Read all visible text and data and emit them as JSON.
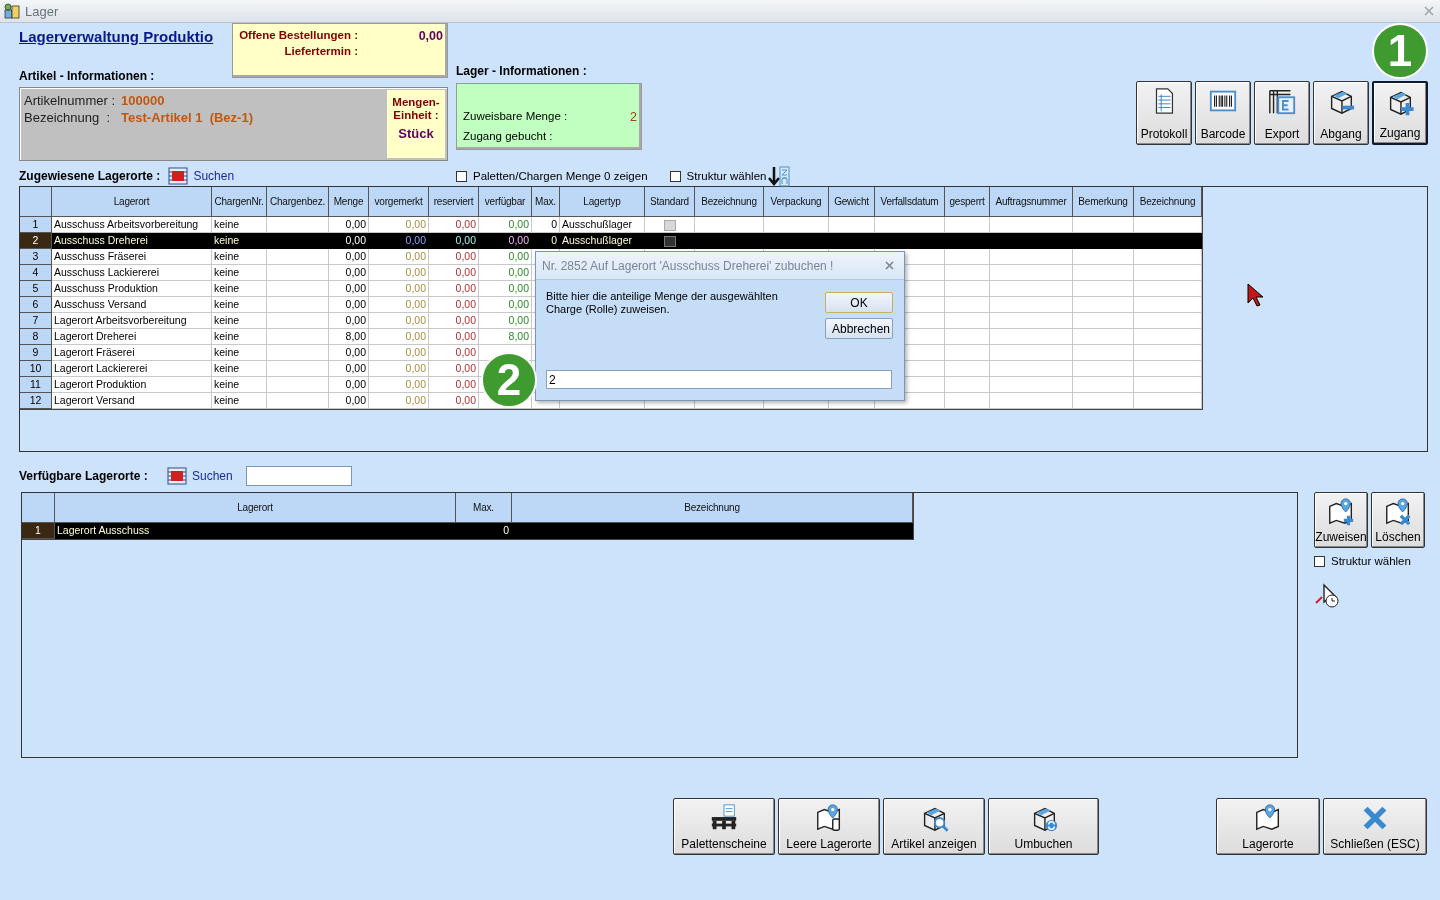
{
  "window": {
    "title": "Lager"
  },
  "header": {
    "title": "Lagerverwaltung Produktio"
  },
  "orders": {
    "open_label": "Offene Bestellungen :",
    "open_value": "0,00",
    "delivery_label": "Liefertermin :"
  },
  "article": {
    "section_label": "Artikel - Informationen :",
    "number_label": "Artikelnummer :",
    "number": "100000",
    "name_label": "Bezeichnung  :",
    "name": "Test-Artikel 1  (Bez-1)",
    "unit_label": "Mengen-Einheit :",
    "unit": "Stück"
  },
  "storage": {
    "section_label": "Lager - Informationen :",
    "assignable_label": "Zuweisbare Menge :",
    "assignable_value": "2",
    "booked_label": "Zugang gebucht :"
  },
  "toolbar": [
    {
      "label": "Protokoll",
      "selected": false
    },
    {
      "label": "Barcode",
      "selected": false
    },
    {
      "label": "Export",
      "selected": false
    },
    {
      "label": "Abgang",
      "selected": false
    },
    {
      "label": "Zugang",
      "selected": true
    }
  ],
  "callouts": [
    {
      "label": "1"
    },
    {
      "label": "2"
    }
  ],
  "assigned": {
    "label": "Zugewiesene Lagerorte :",
    "search": "Suchen",
    "options": [
      {
        "label": "Paletten/Chargen Menge 0 zeigen",
        "checked": false
      },
      {
        "label": "Struktur wählen",
        "checked": false
      }
    ],
    "table": {
      "columns": [
        "Lagerort",
        "ChargenNr.",
        "Chargenbez.",
        "Menge",
        "vorgemerkt",
        "reserviert",
        "verfügbar",
        "Max.",
        "Lagertyp",
        "Standard",
        "Bezeichnung",
        "Verpackung",
        "Gewicht",
        "Verfallsdatum",
        "gesperrt",
        "Auftragsnummer",
        "Bemerkung",
        "Bezeichnung"
      ],
      "rows": [
        {
          "num": "1",
          "lagerort": "Ausschuss Arbeitsvorbereitung",
          "charge": "keine",
          "menge": "0,00",
          "vorgemerkt": "0,00",
          "reserviert": "0,00",
          "verfuegbar": "0,00",
          "max": "0",
          "lagertyp": "Ausschußlager",
          "standard": false,
          "selected": false
        },
        {
          "num": "2",
          "lagerort": "Ausschuss Dreherei",
          "charge": "keine",
          "menge": "0,00",
          "vorgemerkt": "0,00",
          "reserviert": "0,00",
          "verfuegbar": "0,00",
          "max": "0",
          "lagertyp": "Ausschußlager",
          "standard": false,
          "selected": true
        },
        {
          "num": "3",
          "lagerort": "Ausschuss Fräserei",
          "charge": "keine",
          "menge": "0,00",
          "vorgemerkt": "0,00",
          "reserviert": "0,00",
          "verfuegbar": "0,00",
          "selected": false
        },
        {
          "num": "4",
          "lagerort": "Ausschuss Lackiererei",
          "charge": "keine",
          "menge": "0,00",
          "vorgemerkt": "0,00",
          "reserviert": "0,00",
          "verfuegbar": "0,00",
          "selected": false
        },
        {
          "num": "5",
          "lagerort": "Ausschuss Produktion",
          "charge": "keine",
          "menge": "0,00",
          "vorgemerkt": "0,00",
          "reserviert": "0,00",
          "verfuegbar": "0,00",
          "selected": false
        },
        {
          "num": "6",
          "lagerort": "Ausschuss Versand",
          "charge": "keine",
          "menge": "0,00",
          "vorgemerkt": "0,00",
          "reserviert": "0,00",
          "verfuegbar": "0,00",
          "selected": false
        },
        {
          "num": "7",
          "lagerort": "Lagerort Arbeitsvorbereitung",
          "charge": "keine",
          "menge": "0,00",
          "vorgemerkt": "0,00",
          "reserviert": "0,00",
          "verfuegbar": "0,00",
          "selected": false
        },
        {
          "num": "8",
          "lagerort": "Lagerort Dreherei",
          "charge": "keine",
          "menge": "8,00",
          "vorgemerkt": "0,00",
          "reserviert": "0,00",
          "verfuegbar": "8,00",
          "selected": false
        },
        {
          "num": "9",
          "lagerort": "Lagerort Fräserei",
          "charge": "keine",
          "menge": "0,00",
          "vorgemerkt": "0,00",
          "reserviert": "0,00",
          "selected": false
        },
        {
          "num": "10",
          "lagerort": "Lagerort Lackiererei",
          "charge": "keine",
          "menge": "0,00",
          "vorgemerkt": "0,00",
          "reserviert": "0,00",
          "selected": false
        },
        {
          "num": "11",
          "lagerort": "Lagerort Produktion",
          "charge": "keine",
          "menge": "0,00",
          "vorgemerkt": "0,00",
          "reserviert": "0,00",
          "selected": false
        },
        {
          "num": "12",
          "lagerort": "Lagerort Versand",
          "charge": "keine",
          "menge": "0,00",
          "vorgemerkt": "0,00",
          "reserviert": "0,00",
          "selected": false
        }
      ]
    }
  },
  "dialog": {
    "title": "Nr. 2852 Auf Lagerort 'Ausschuss Dreherei' zubuchen !",
    "message": "Bitte hier die anteilige Menge der ausgewählten Charge (Rolle) zuweisen.",
    "value": "2",
    "buttons": [
      {
        "label": "OK"
      },
      {
        "label": "Abbrechen"
      }
    ]
  },
  "available": {
    "label": "Verfügbare Lagerorte :",
    "search": "Suchen",
    "table": {
      "columns": [
        "Lagerort",
        "Max.",
        "Bezeichnung"
      ],
      "rows": [
        {
          "num": "1",
          "lagerort": "Lagerort Ausschuss",
          "max": "0",
          "selected": true
        }
      ]
    },
    "buttons": [
      {
        "label": "Zuweisen"
      },
      {
        "label": "Löschen"
      }
    ],
    "option": {
      "label": "Struktur wählen",
      "checked": false
    }
  },
  "bottom_buttons": [
    {
      "label": "Palettenscheine"
    },
    {
      "label": "Leere Lagerorte"
    },
    {
      "label": "Artikel anzeigen"
    },
    {
      "label": "Umbuchen"
    },
    {
      "label": "Lagerorte"
    },
    {
      "label": "Schließen (ESC)"
    }
  ]
}
